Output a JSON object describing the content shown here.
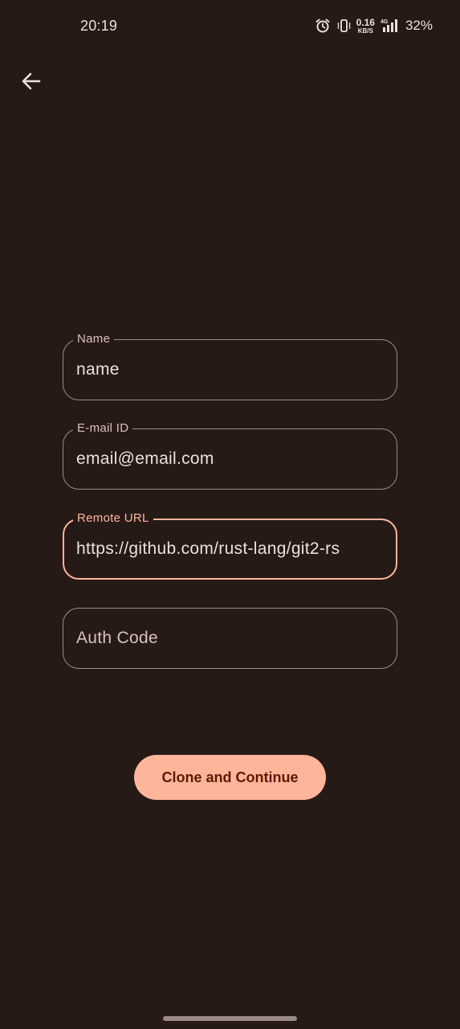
{
  "status_bar": {
    "time": "20:19",
    "net_speed_value": "0.16",
    "net_speed_unit": "KB/S",
    "network_type": "4G",
    "battery": "32%",
    "icons": [
      "alarm-icon",
      "vibrate-icon",
      "signal-icon"
    ]
  },
  "toolbar": {
    "back_icon": "arrow-back-icon"
  },
  "form": {
    "name": {
      "label": "Name",
      "value": "name"
    },
    "email": {
      "label": "E-mail ID",
      "value": "email@email.com"
    },
    "remote_url": {
      "label": "Remote URL",
      "value": "https://github.com/rust-lang/git2-rs"
    },
    "auth_code": {
      "placeholder": "Auth Code",
      "value": ""
    }
  },
  "actions": {
    "clone_label": "Clone and Continue"
  },
  "colors": {
    "background": "#261a16",
    "accent": "#ffb59a",
    "outline": "#a08c85",
    "text": "#efdfd9",
    "button_text": "#5c1a00"
  }
}
